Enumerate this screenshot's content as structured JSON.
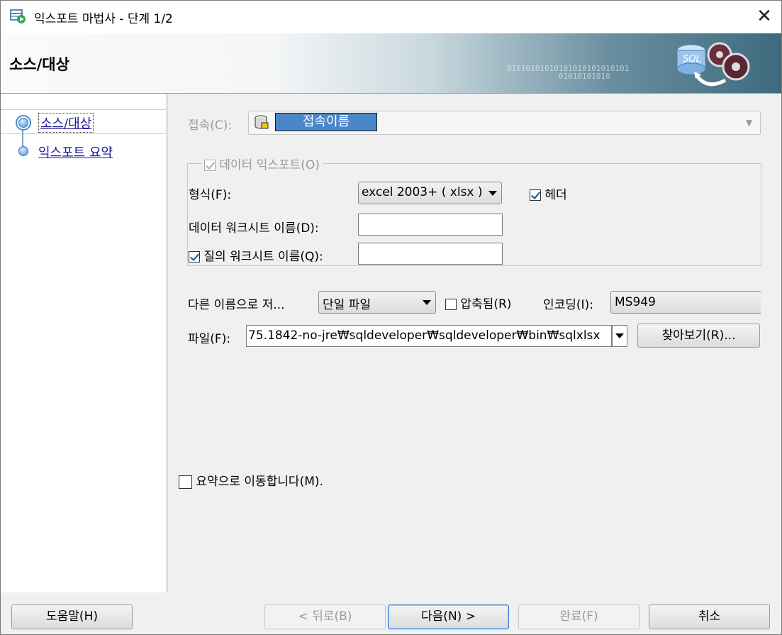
{
  "window": {
    "title": "익스포트 마법사 - 단계 1/2"
  },
  "banner": {
    "title": "소스/대상",
    "digits": "01010101010101010101010101\n           01010101010"
  },
  "nav": {
    "items": [
      {
        "label": "소스/대상"
      },
      {
        "label": "익스포트 요약"
      }
    ]
  },
  "connection": {
    "label": "접속(C):",
    "value": "접속이름"
  },
  "export_data": {
    "label": "데이터 익스포트(O)",
    "checked": true
  },
  "format": {
    "label": "형식(F):",
    "value": "excel 2003+ ( xlsx )"
  },
  "header": {
    "label": "헤더",
    "checked": true
  },
  "data_sheet": {
    "label": "데이터 워크시트 이름(D):",
    "value": ""
  },
  "query_sheet": {
    "label": "질의 워크시트 이름(Q):",
    "value": "",
    "checked": true
  },
  "save_as": {
    "label": "다른 이름으로 저...",
    "value": "단일 파일"
  },
  "compressed": {
    "label": "압축됨(R)",
    "checked": false
  },
  "encoding": {
    "label": "인코딩(I):",
    "value": "MS949"
  },
  "file": {
    "label": "파일(F):",
    "value": "75.1842-no-jre₩sqldeveloper₩sqldeveloper₩bin₩sqlxlsx",
    "browse": "찾아보기(R)..."
  },
  "summary_jump": {
    "label": "요약으로 이동합니다(M).",
    "checked": false
  },
  "buttons": {
    "help": "도움말(H)",
    "back": "< 뒤로(B)",
    "next": "다음(N) >",
    "finish": "완료(F)",
    "cancel": "취소"
  },
  "colors": {
    "connection_highlight": "#4a86c8",
    "link": "#1a1a9a"
  }
}
